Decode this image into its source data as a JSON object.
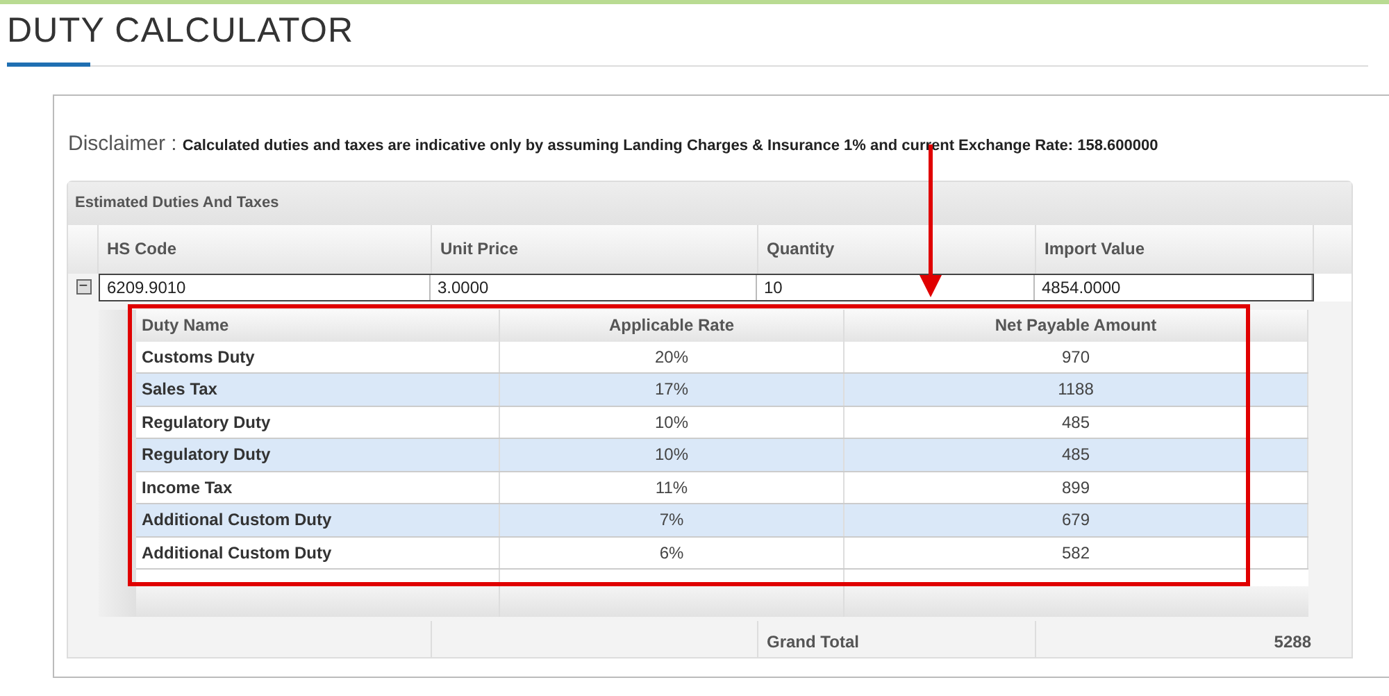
{
  "page_title": "DUTY CALCULATOR",
  "disclaimer": {
    "label": "Disclaimer :",
    "text": "Calculated duties and taxes are indicative only by assuming Landing Charges & Insurance 1% and current Exchange Rate: 158.600000"
  },
  "panel": {
    "title": "Estimated Duties And Taxes",
    "columns": [
      "HS Code",
      "Unit Price",
      "Quantity",
      "Import Value"
    ],
    "rows": [
      {
        "expander": "−",
        "expanded": true,
        "cells": [
          "6209.9010",
          "3.0000",
          "10",
          "4854.0000"
        ]
      }
    ],
    "detail": {
      "columns": [
        "Duty Name",
        "Applicable Rate",
        "Net Payable Amount"
      ],
      "rows": [
        {
          "cells": [
            "Customs Duty",
            "20%",
            "970"
          ]
        },
        {
          "cells": [
            "Sales Tax",
            "17%",
            "1188"
          ]
        },
        {
          "cells": [
            "Regulatory Duty",
            "10%",
            "485"
          ]
        },
        {
          "cells": [
            "Regulatory Duty",
            "10%",
            "485"
          ]
        },
        {
          "cells": [
            "Income Tax",
            "11%",
            "899"
          ]
        },
        {
          "cells": [
            "Additional Custom Duty",
            "7%",
            "679"
          ]
        },
        {
          "cells": [
            "Additional Custom Duty",
            "6%",
            "582"
          ]
        }
      ]
    },
    "footer": {
      "label": "Grand Total",
      "value": "5288"
    }
  }
}
